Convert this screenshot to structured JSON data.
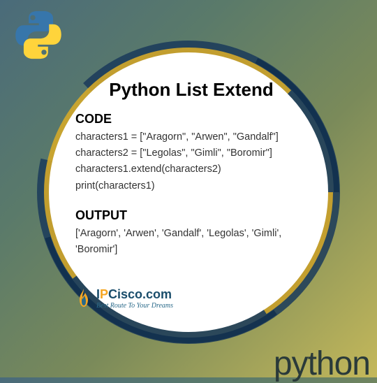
{
  "title": "Python List Extend",
  "code": {
    "header": "CODE",
    "lines": [
      "characters1 = [\"Aragorn\", \"Arwen\", \"Gandalf\"]",
      "characters2 = [\"Legolas\", \"Gimli\", \"Boromir\"]",
      "characters1.extend(characters2)",
      "print(characters1)"
    ]
  },
  "output": {
    "header": "OUTPUT",
    "text": "['Aragorn', 'Arwen', 'Gandalf', 'Legolas', 'Gimli', 'Boromir']"
  },
  "branding": {
    "name_i": "I",
    "name_p": "P",
    "name_rest": "Cisco.com",
    "tagline": "Best Route To Your Dreams"
  },
  "footer_text": "python"
}
